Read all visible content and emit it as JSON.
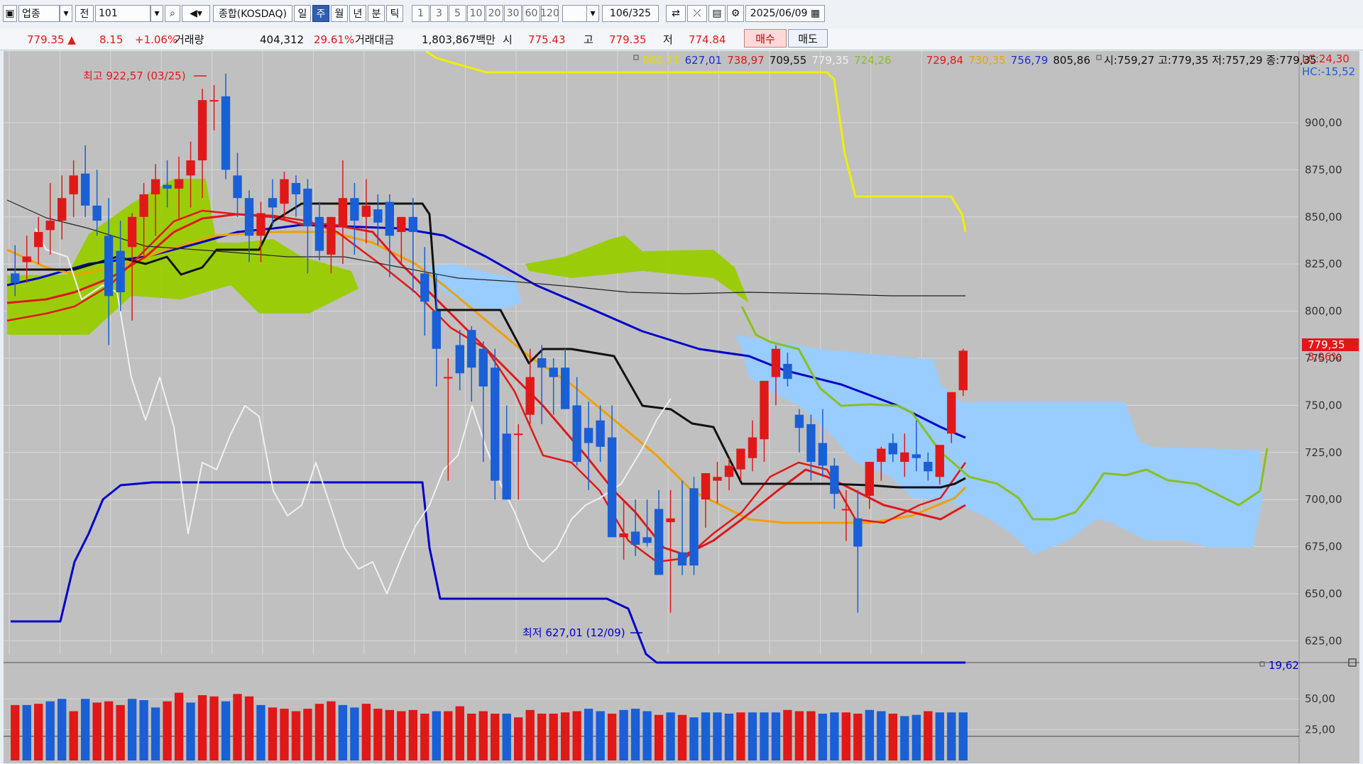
{
  "toolbar": {
    "market_type": "업종",
    "prefix": "전",
    "code": "101",
    "index_name": "종합(KOSDAQ)",
    "periods": [
      "일",
      "주",
      "월",
      "년",
      "분",
      "틱"
    ],
    "active_period": "주",
    "intervals": [
      "1",
      "3",
      "5",
      "10",
      "20",
      "30",
      "60",
      "120"
    ],
    "page_counter": "106/325",
    "date": "2025/06/09"
  },
  "quote": {
    "price": "779.35 ▲",
    "change": "8.15",
    "change_pct": "+1.06%",
    "volume_label": "거래량",
    "volume": "404,312",
    "volume_ratio": "29.61%",
    "value_label": "거래대금",
    "value": "1,803,867백만",
    "open_label": "시",
    "open": "775.43",
    "high_label": "고",
    "high": "779.35",
    "low_label": "저",
    "low": "774.84",
    "buy_label": "매수",
    "sell_label": "매도"
  },
  "legend": {
    "values": [
      {
        "text": "866,21",
        "color": "#e8d800"
      },
      {
        "text": "627,01",
        "color": "#1a2fd6"
      },
      {
        "text": "738,97",
        "color": "#e01818"
      },
      {
        "text": "709,55",
        "color": "#111111"
      },
      {
        "text": "779,35",
        "color": "#f0f0f0"
      },
      {
        "text": "724,26",
        "color": "#88c020"
      },
      {
        "text": "729,84",
        "color": "#e01818"
      },
      {
        "text": "730,35",
        "color": "#f0a000"
      },
      {
        "text": "756,79",
        "color": "#1a2fd6"
      },
      {
        "text": "805,86",
        "color": "#111111"
      }
    ],
    "ohlc_text": "시:759,27 고:779,35 저:757,29 종:779,35",
    "lc": "LC:24,30",
    "hc": "HC:-15,52"
  },
  "annotations": {
    "high": "최고 922,57 (03/25)",
    "low": "최저 627,01 (12/09)",
    "last_price": "779,35",
    "last_pct": "3,06%",
    "volume_value": "19,62"
  },
  "chart_data": {
    "type": "candlestick",
    "y_axis_ticks": [
      "900,00",
      "875,00",
      "850,00",
      "825,00",
      "800,00",
      "775,00",
      "750,00",
      "725,00",
      "700,00",
      "675,00",
      "650,00",
      "625,00"
    ],
    "ylim": [
      618,
      935
    ],
    "volume_axis_ticks": [
      "50,00",
      "25,00"
    ],
    "volume_ylim": [
      0,
      72
    ],
    "candles": [
      [
        820,
        835,
        808,
        815
      ],
      [
        826,
        840,
        815,
        829
      ],
      [
        834,
        850,
        825,
        842
      ],
      [
        843,
        868,
        830,
        848
      ],
      [
        848,
        872,
        838,
        860
      ],
      [
        862,
        880,
        850,
        872
      ],
      [
        873,
        888,
        850,
        856
      ],
      [
        856,
        875,
        840,
        848
      ],
      [
        840,
        860,
        782,
        808
      ],
      [
        832,
        848,
        800,
        810
      ],
      [
        834,
        852,
        795,
        850
      ],
      [
        850,
        868,
        828,
        862
      ],
      [
        862,
        878,
        840,
        870
      ],
      [
        867,
        880,
        855,
        865
      ],
      [
        865,
        882,
        848,
        870
      ],
      [
        872,
        890,
        855,
        880
      ],
      [
        880,
        918,
        860,
        912
      ],
      [
        912,
        920,
        896,
        912
      ],
      [
        914,
        926,
        870,
        875
      ],
      [
        872,
        884,
        850,
        860
      ],
      [
        860,
        864,
        826,
        840
      ],
      [
        840,
        858,
        826,
        852
      ],
      [
        860,
        870,
        845,
        855
      ],
      [
        857,
        874,
        848,
        870
      ],
      [
        868,
        872,
        850,
        862
      ],
      [
        865,
        870,
        820,
        845
      ],
      [
        850,
        858,
        827,
        832
      ],
      [
        830,
        850,
        820,
        850
      ],
      [
        845,
        880,
        825,
        860
      ],
      [
        860,
        868,
        830,
        848
      ],
      [
        850,
        870,
        836,
        856
      ],
      [
        854,
        862,
        835,
        847
      ],
      [
        858,
        862,
        818,
        840
      ],
      [
        842,
        848,
        825,
        850
      ],
      [
        850,
        860,
        810,
        842
      ],
      [
        820,
        834,
        787,
        805
      ],
      [
        800,
        820,
        760,
        780
      ],
      [
        765,
        775,
        710,
        765
      ],
      [
        782,
        790,
        758,
        767
      ],
      [
        790,
        792,
        752,
        770
      ],
      [
        780,
        784,
        720,
        760
      ],
      [
        770,
        780,
        700,
        710
      ],
      [
        735,
        750,
        700,
        700
      ],
      [
        735,
        740,
        700,
        735
      ],
      [
        745,
        780,
        740,
        765
      ],
      [
        775,
        782,
        740,
        770
      ],
      [
        770,
        775,
        745,
        765
      ],
      [
        770,
        780,
        748,
        748
      ],
      [
        750,
        765,
        718,
        720
      ],
      [
        738,
        752,
        705,
        730
      ],
      [
        742,
        750,
        720,
        728
      ],
      [
        733,
        750,
        690,
        680
      ],
      [
        680,
        700,
        668,
        682
      ],
      [
        683,
        700,
        670,
        676
      ],
      [
        680,
        700,
        675,
        677
      ],
      [
        695,
        705,
        668,
        660
      ],
      [
        688,
        705,
        640,
        690
      ],
      [
        672,
        710,
        660,
        665
      ],
      [
        706,
        712,
        660,
        665
      ],
      [
        700,
        708,
        685,
        714
      ],
      [
        710,
        720,
        698,
        712
      ],
      [
        712,
        722,
        705,
        718
      ],
      [
        716,
        726,
        710,
        727
      ],
      [
        722,
        742,
        715,
        733
      ],
      [
        732,
        760,
        720,
        763
      ],
      [
        765,
        782,
        750,
        780
      ],
      [
        772,
        778,
        760,
        764
      ],
      [
        745,
        748,
        725,
        738
      ],
      [
        740,
        745,
        710,
        720
      ],
      [
        730,
        748,
        712,
        718
      ],
      [
        718,
        722,
        695,
        703
      ],
      [
        695,
        705,
        678,
        695
      ],
      [
        690,
        705,
        640,
        675
      ],
      [
        702,
        710,
        695,
        720
      ],
      [
        720,
        728,
        710,
        727
      ],
      [
        730,
        735,
        720,
        724
      ],
      [
        720,
        735,
        712,
        725
      ],
      [
        724,
        742,
        715,
        722
      ],
      [
        720,
        725,
        710,
        715
      ],
      [
        712,
        726,
        708,
        729
      ],
      [
        735,
        748,
        730,
        757
      ],
      [
        758,
        780,
        755,
        779
      ]
    ],
    "volumes": [
      45,
      45,
      46,
      48,
      50,
      40,
      50,
      47,
      48,
      45,
      50,
      49,
      43,
      48,
      55,
      47,
      53,
      52,
      48,
      54,
      52,
      45,
      43,
      42,
      40,
      42,
      46,
      48,
      45,
      43,
      46,
      42,
      41,
      40,
      41,
      38,
      40,
      40,
      44,
      38,
      40,
      38,
      38,
      35,
      41,
      38,
      38,
      39,
      40,
      42,
      40,
      38,
      41,
      42,
      40,
      37,
      39,
      37,
      35,
      39,
      39,
      38,
      39,
      39,
      39,
      39,
      41,
      40,
      40,
      38,
      39,
      39,
      38,
      41,
      40,
      38,
      36,
      37,
      40,
      39,
      39,
      39
    ],
    "volume_colors_up": [
      false,
      true,
      false,
      true,
      true,
      false,
      true,
      false,
      false,
      false,
      true,
      true,
      true,
      false,
      false,
      true,
      false,
      false,
      true,
      false,
      false,
      true,
      false,
      false,
      false,
      false,
      false,
      false,
      true,
      true,
      false,
      false,
      false,
      false,
      false,
      false,
      true,
      false,
      false,
      false,
      false,
      false,
      true,
      false,
      false,
      false,
      false,
      false,
      false,
      true,
      true,
      false,
      true,
      true,
      true,
      false,
      true,
      false,
      true,
      true,
      true,
      true,
      false,
      true,
      true,
      true,
      false,
      false,
      false,
      true,
      true,
      false,
      false,
      true,
      true,
      false,
      true,
      true,
      false,
      true,
      true,
      true
    ]
  }
}
